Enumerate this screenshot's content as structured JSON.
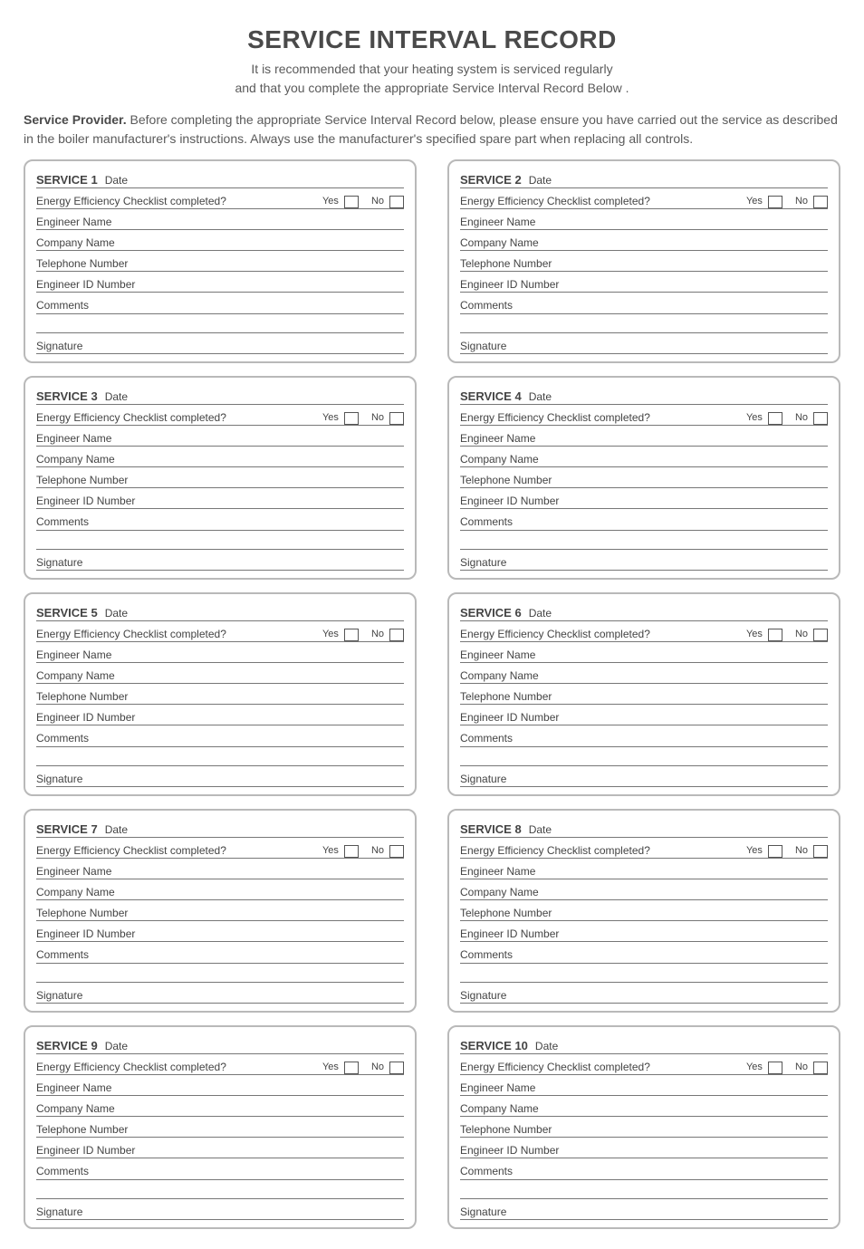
{
  "title": "SERVICE INTERVAL RECORD",
  "intro_line1": "It is recommended that your heating system is serviced regularly",
  "intro_line2": "and that you complete the appropriate Service Interval Record Below .",
  "provider_lead": "Service Provider.",
  "provider_body": " Before completing the appropriate Service Interval Record below, please ensure you have carried out the service as described in the boiler manufacturer's instructions. Always use the manufacturer's specified spare part when replacing all controls.",
  "labels": {
    "date": "Date",
    "checklist": "Energy Efficiency Checklist completed?",
    "yes": "Yes",
    "no": "No",
    "engineer_name": "Engineer Name",
    "company_name": "Company Name",
    "telephone": "Telephone Number",
    "engineer_id": "Engineer ID Number",
    "comments": "Comments",
    "signature": "Signature"
  },
  "services": [
    {
      "heading": "SERVICE 1"
    },
    {
      "heading": "SERVICE 2"
    },
    {
      "heading": "SERVICE 3"
    },
    {
      "heading": "SERVICE 4"
    },
    {
      "heading": "SERVICE 5"
    },
    {
      "heading": "SERVICE 6"
    },
    {
      "heading": "SERVICE 7"
    },
    {
      "heading": "SERVICE 8"
    },
    {
      "heading": "SERVICE 9"
    },
    {
      "heading": "SERVICE 10"
    }
  ]
}
